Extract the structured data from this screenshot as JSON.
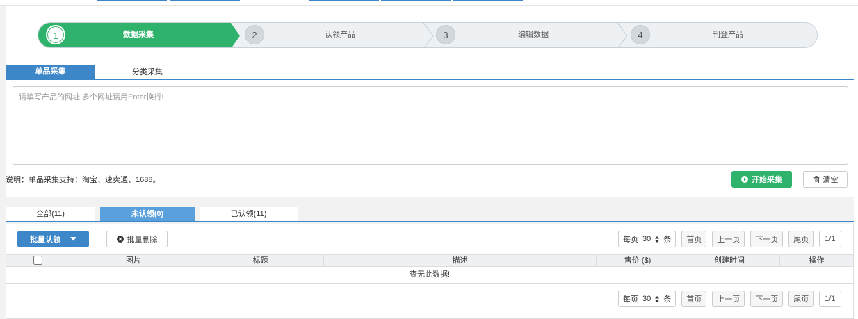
{
  "wizard": {
    "steps": [
      {
        "num": "1",
        "label": "数据采集"
      },
      {
        "num": "2",
        "label": "认领产品"
      },
      {
        "num": "3",
        "label": "编辑数据"
      },
      {
        "num": "4",
        "label": "刊登产品"
      }
    ]
  },
  "collect": {
    "tabs": [
      {
        "label": "单品采集"
      },
      {
        "label": "分类采集"
      }
    ],
    "url_placeholder": "请填写产品的网址,多个网址请用Enter换行!",
    "url_value": "",
    "note": "说明：单品采集支持：淘宝、速卖通、1688。",
    "start_label": "开始采集",
    "clear_label": "清空"
  },
  "list": {
    "tabs": [
      {
        "label": "全部(11)"
      },
      {
        "label": "未认领(0)"
      },
      {
        "label": "已认领(11)"
      }
    ],
    "batch_claim_label": "批量认领",
    "batch_delete_label": "批量删除",
    "columns": [
      "图片",
      "标题",
      "描述",
      "售价 ($)",
      "创建时间",
      "操作"
    ],
    "empty_text": "查无此数据!",
    "pager": {
      "per_page_label": "每页",
      "per_page_value": "30",
      "unit": "条",
      "first": "首页",
      "prev": "上一页",
      "next": "下一页",
      "last": "尾页",
      "info": "1/1"
    }
  },
  "colors": {
    "green": "#2fb26b",
    "blue": "#3d87c9",
    "light_blue": "#5aa0dc"
  }
}
